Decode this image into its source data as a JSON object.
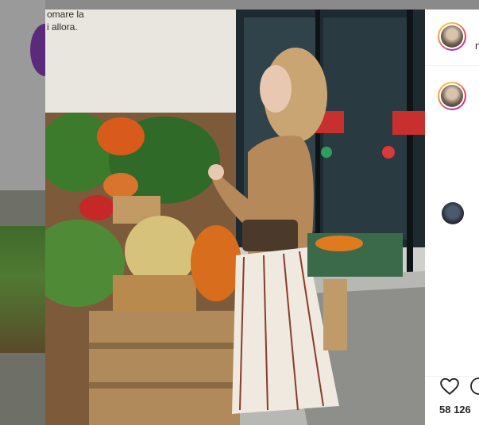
{
  "post": {
    "sign_line1": "omare la",
    "sign_line2": "i allora.",
    "likes_text": "58 126 ",
    "author_initial": "n"
  },
  "icons": [
    "heart-icon",
    "comment-icon"
  ],
  "colors": {
    "accent": "#e0386d",
    "side_bg": "#ffffff",
    "text": "#262626"
  }
}
